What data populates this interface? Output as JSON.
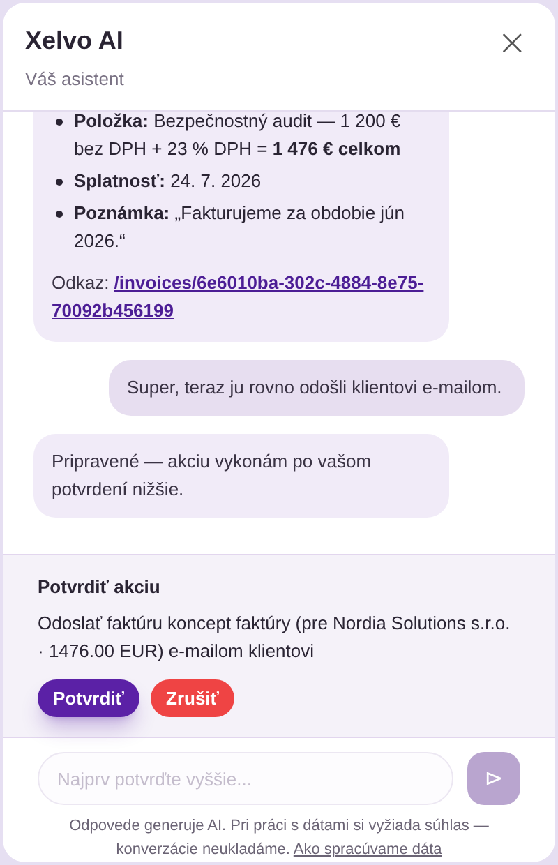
{
  "header": {
    "title": "Xelvo AI",
    "subtitle": "Váš asistent",
    "close": "×"
  },
  "messages": [
    {
      "kind": "assistant",
      "items": [
        "**Položka:** Bezpečnostný audit — 1 200 € bez DPH + 23 % DPH = **1 476 € celkom**",
        "**Splatnosť:** 24. 7. 2026",
        "**Poznámka:** „Fakturujeme za obdobie jún 2026.“"
      ],
      "link_label": "Odkaz:",
      "link": "/invoices/6e6010ba-302c-4884-8e75-70092b456199"
    },
    {
      "kind": "user",
      "text": "Super, teraz ju rovno odošli klientovi e-mailom."
    },
    {
      "kind": "assistant",
      "text": "Pripravené — akciu vykonám po vašom potvrdení nižšie."
    }
  ],
  "confirm": {
    "title": "Potvrdiť akciu",
    "text": "Odoslať faktúru koncept faktúry (pre Nordia Solutions s.r.o. · 1476.00 EUR) e-mailom klientovi",
    "buttons": [
      {
        "label": "Potvrdiť",
        "kind": "primary"
      },
      {
        "label": "Zrušiť",
        "kind": "danger"
      }
    ]
  },
  "composer": {
    "placeholder": "Najprv potvrďte vyššie...",
    "disabled": true,
    "send": "⊳"
  },
  "footer": {
    "text": "Odpovede generuje AI. Pri práci s dátami si vyžiada súhlas — konverzácie neukladáme.",
    "link": "Ako spracúvame dáta"
  }
}
